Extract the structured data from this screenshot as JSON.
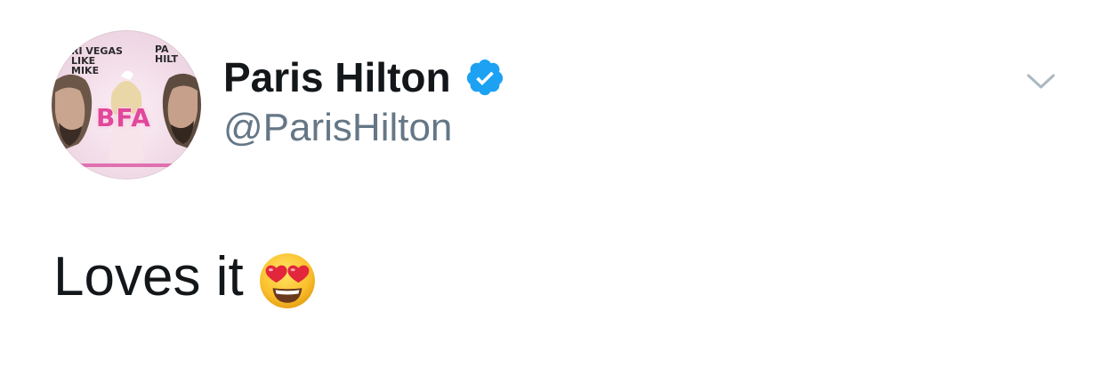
{
  "tweet": {
    "author": {
      "display_name": "Paris Hilton",
      "handle": "@ParisHilton",
      "verified": true,
      "avatar": {
        "text_left": "RI VEGAS\nLIKE MIKE",
        "text_right": "PA\nHILT",
        "logo": "BFA",
        "icon": "avatar-image"
      }
    },
    "text": "Loves it",
    "emoji": "heart-eyes-emoji",
    "menu_icon": "chevron-down-icon"
  },
  "colors": {
    "name": "#14171a",
    "handle": "#657786",
    "verified_badge": "#1da1f2",
    "chevron": "#aab8c2",
    "emoji_face": "#fbc02d",
    "emoji_hearts": "#e2263b"
  }
}
